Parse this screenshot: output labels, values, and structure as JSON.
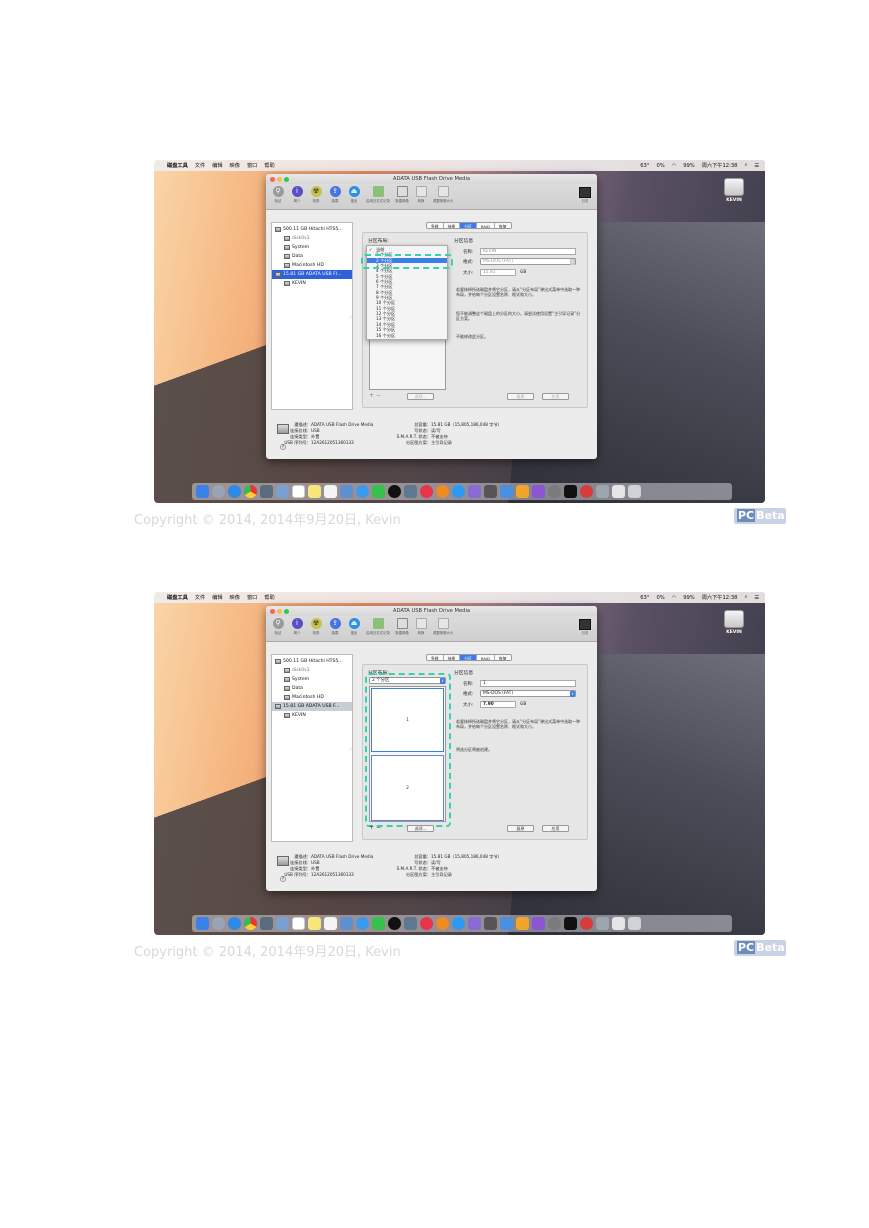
{
  "menubar": {
    "app": "磁盘工具",
    "items": [
      "文件",
      "编辑",
      "映像",
      "窗口",
      "帮助"
    ],
    "temp": "63°",
    "battery": "99%",
    "vol": "0%",
    "clock": "周六下午12:38"
  },
  "desktop_disk": {
    "label": "KEVIN"
  },
  "window": {
    "title": "ADATA USB Flash Drive Media",
    "toolbar": [
      "验证",
      "简介",
      "刻录",
      "装载",
      "推出",
      "启用日志式记录",
      "新建映像",
      "转换",
      "调整映像大小"
    ],
    "log_label": "日志"
  },
  "sidebar": [
    {
      "label": "500.11 GB Hitachi HTS5...",
      "indent": false
    },
    {
      "label": "disk0s3",
      "indent": true
    },
    {
      "label": "System",
      "indent": true
    },
    {
      "label": "Data",
      "indent": true
    },
    {
      "label": "Macintosh HD",
      "indent": true
    },
    {
      "label_1": "15.81 GB ADATA USB Fl...",
      "label_2": "15.81 GB ADATA USB F...",
      "indent": false
    },
    {
      "label": "KEVIN",
      "indent": true
    }
  ],
  "tabs": [
    "急救",
    "抹掉",
    "分区",
    "RAID",
    "恢复"
  ],
  "partition": {
    "layout_label": "分区布局:",
    "info_label": "分区信息",
    "name_label": "名称:",
    "format_label": "格式:",
    "size_label": "大小:",
    "size_unit": "GB",
    "shot1": {
      "name": "KEVIN",
      "format": "MS-DOS (FAT)",
      "size": "15.81",
      "info_1": "若要抹掉所选磁盘并将它分区，请从“分区布局”弹出式菜单中选取一种布局，并给每个分区设置名称、格式和大小。",
      "info_2": "若要抹掉所选磁盘并将它分区，请从“分区布局”弹出式菜单中选取一种布局，并给每个分区设置名称、格式和大小。",
      "info_2b": "您不能调整这个磁盘上的分区的大小。请尝试使用设置“主引导记录”分区方案。",
      "info_3": "不能修改此分区。",
      "options_label": "选项...",
      "revert_label": "复原",
      "apply_label": "应用",
      "dropdown": [
        "当前",
        "1 个分区",
        "2 个分区",
        "3 个分区",
        "4 个分区",
        "5 个分区",
        "6 个分区",
        "7 个分区",
        "8 个分区",
        "9 个分区",
        "10 个分区",
        "11 个分区",
        "12 个分区",
        "13 个分区",
        "14 个分区",
        "15 个分区",
        "16 个分区"
      ]
    },
    "shot2": {
      "layout_value": "2 个分区",
      "name": "1",
      "format": "MS-DOS (FAT)",
      "size": "7.90",
      "info_1": "若要抹掉所选磁盘并将它分区，请从“分区布局”弹出式菜单中选取一种布局，并给每个分区设置名称、格式和大小。",
      "info_2": "将选分区将被创建。",
      "part_1": "1",
      "part_2": "2",
      "options_label": "选项...",
      "revert_label": "复原",
      "apply_label": "应用"
    }
  },
  "footer": {
    "desc_k": "遭描述：",
    "desc_v": "ADATA USB Flash Drive Media",
    "bus_k": "连接总线：",
    "bus_v": "USB",
    "type_k": "连接类型：",
    "type_v": "外置",
    "serial_k": "USB 序列号：",
    "serial_v": "12A2612051360133",
    "cap_k": "总容量：",
    "cap_v": "15.81 GB（15,805,186,048 字节）",
    "write_k": "写状态：",
    "write_v": "读/写",
    "smart_k": "S.M.A.R.T. 状态：",
    "smart_v": "不被支持",
    "scheme_k": "分区图方案：",
    "scheme_v": "主引导记录"
  },
  "help_icon": "?",
  "copyright": "Copyright © 2014, 2014年9月20日, Kevin",
  "brand": {
    "a": "PC",
    "b": "Beta"
  }
}
